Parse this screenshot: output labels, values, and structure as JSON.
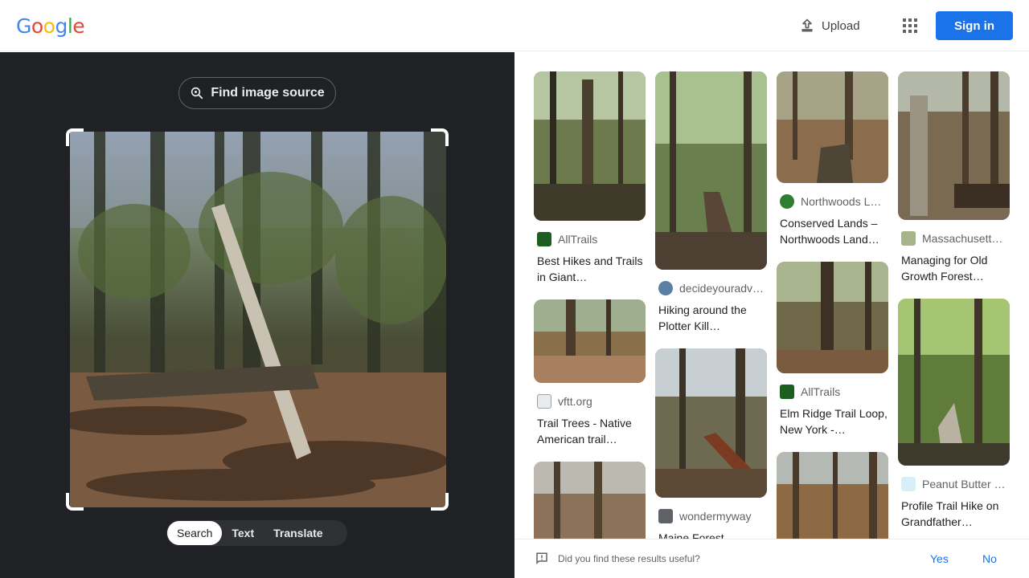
{
  "header": {
    "logo": "Google",
    "upload_label": "Upload",
    "signin_label": "Sign in"
  },
  "lens": {
    "find_source_label": "Find image source",
    "modes": [
      "Search",
      "Text",
      "Translate"
    ],
    "active_mode": "Search"
  },
  "results": [
    {
      "source": "AllTrails",
      "title": "Best Hikes and Trails in Giant…"
    },
    {
      "source": "vftt.org",
      "title": "Trail Trees - Native American trail…"
    },
    {
      "source": "decideyouradv…",
      "title": "Hiking around the Plotter Kill…"
    },
    {
      "source": "wondermyway",
      "title": "Maine Forest"
    },
    {
      "source": "Northwoods L…",
      "title": "Conserved Lands – Northwoods Land…"
    },
    {
      "source": "AllTrails",
      "title": "Elm Ridge Trail Loop, New York -…"
    },
    {
      "source": "Massachusett…",
      "title": "Managing for Old Growth Forest…"
    },
    {
      "source": "Peanut Butter …",
      "title": "Profile Trail Hike on Grandfather…"
    }
  ],
  "feedback": {
    "question": "Did you find these results useful?",
    "yes": "Yes",
    "no": "No"
  },
  "colors": {
    "accent": "#1a73e8",
    "panel_bg": "#202124"
  }
}
